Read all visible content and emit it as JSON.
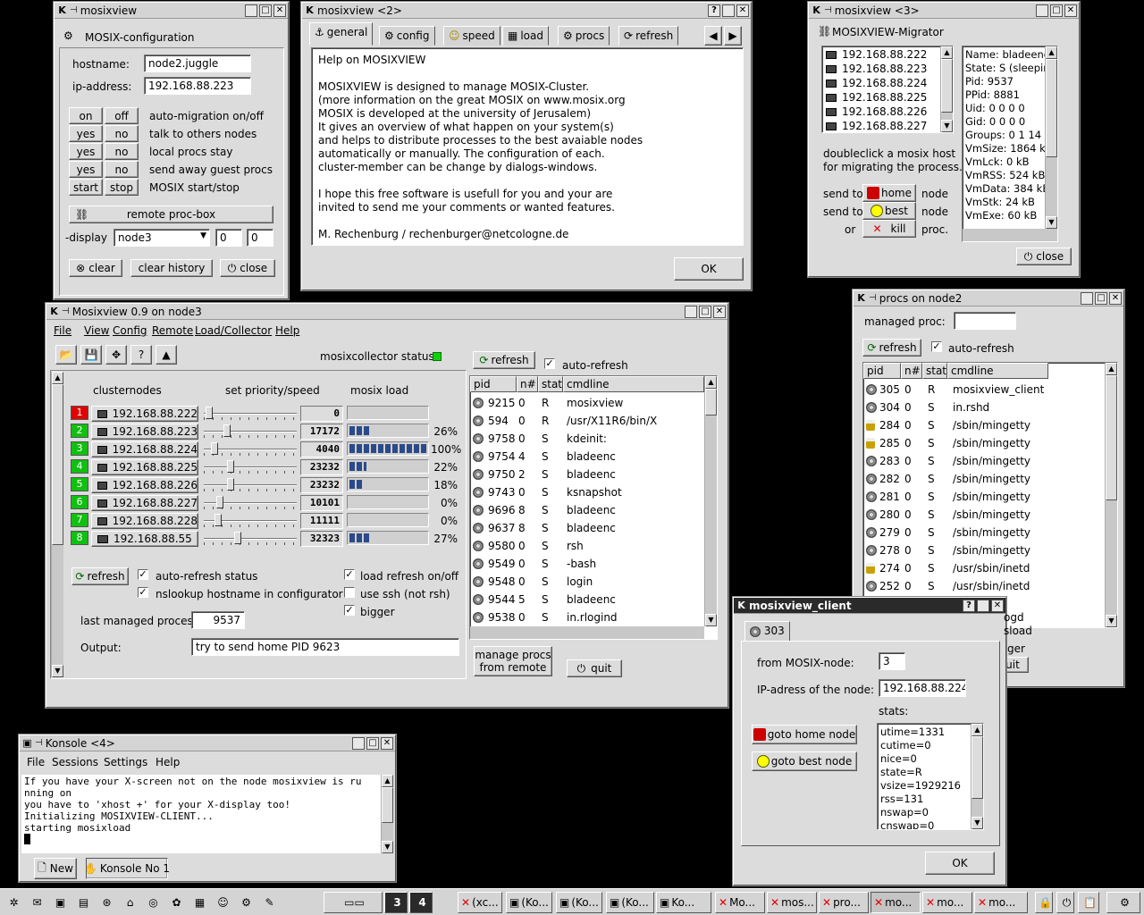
{
  "config_win": {
    "title": "mosixview",
    "heading": "MOSIX-configuration",
    "hostname_label": "hostname:",
    "hostname": "node2.juggle",
    "ip_label": "ip-address:",
    "ip": "192.168.88.223",
    "toggles": [
      {
        "a": "on",
        "b": "off",
        "desc": "auto-migration on/off"
      },
      {
        "a": "yes",
        "b": "no",
        "desc": "talk to others nodes"
      },
      {
        "a": "yes",
        "b": "no",
        "desc": "local procs stay"
      },
      {
        "a": "yes",
        "b": "no",
        "desc": "send away guest procs"
      },
      {
        "a": "start",
        "b": "stop",
        "desc": "MOSIX start/stop"
      }
    ],
    "remote_btn": "remote proc-box",
    "display_label": "-display",
    "display_value": "node3",
    "spin1": "0",
    "spin2": "0",
    "clear": "clear",
    "clear_history": "clear history",
    "close": "close"
  },
  "help_win": {
    "title": "mosixview <2>",
    "tabs": [
      "general",
      "config",
      "speed",
      "load",
      "procs",
      "refresh"
    ],
    "lines": [
      "Help on MOSIXVIEW",
      "",
      "MOSIXVIEW is designed to manage MOSIX-Cluster.",
      "(more information on the great MOSIX on www.mosix.org",
      "MOSIX is developed at the university of Jerusalem)",
      "It gives an overview of what happen on your system(s)",
      "and helps to distribute processes to the best avaiable nodes",
      "automatically or manually. The configuration of each.",
      "cluster-member can be change by dialogs-windows.",
      "",
      "I hope this free software is usefull for you and your are",
      "invited to send me your comments or wanted features.",
      "",
      "M. Rechenburg / rechenburger@netcologne.de"
    ],
    "ok": "OK"
  },
  "migrator_win": {
    "title": "mosixview <3>",
    "heading": "MOSIXVIEW-Migrator",
    "hosts": [
      "192.168.88.222",
      "192.168.88.223",
      "192.168.88.224",
      "192.168.88.225",
      "192.168.88.226",
      "192.168.88.227"
    ],
    "info": [
      "Name: bladeenc",
      "State: S (sleeping",
      "Pid: 9537",
      "PPid: 8881",
      "Uid: 0 0 0 0",
      "Gid: 0 0 0 0",
      "Groups: 0 1 14 15",
      "VmSize: 1864 kB",
      "VmLck: 0 kB",
      "VmRSS: 524 kB",
      "VmData: 384 kB",
      "VmStk: 24 kB",
      "VmExe: 60 kB"
    ],
    "hint1": "doubleclick a mosix host",
    "hint2": "for migrating the process.",
    "send_to": "send to",
    "or": "or",
    "home": "home",
    "best": "best",
    "kill": "kill",
    "node": "node",
    "proc": "proc.",
    "close": "close"
  },
  "main_win": {
    "title": "Mosixview 0.9   on node3",
    "menu": [
      "File",
      "View",
      "Config",
      "Remote",
      "Load/Collector",
      "Help"
    ],
    "collector_status": "mosixcollector status",
    "col_nodes": "clusternodes",
    "col_prio": "set priority/speed",
    "col_load": "mosix load",
    "nodes": [
      {
        "n": "1",
        "ip": "192.168.88.222",
        "speed": "0",
        "load": 0,
        "pct": "",
        "color": "#e00000"
      },
      {
        "n": "2",
        "ip": "192.168.88.223",
        "speed": "17172",
        "load": 26,
        "pct": "26%",
        "color": "#10c010"
      },
      {
        "n": "3",
        "ip": "192.168.88.224",
        "speed": "4040",
        "load": 100,
        "pct": "100%",
        "color": "#10c010"
      },
      {
        "n": "4",
        "ip": "192.168.88.225",
        "speed": "23232",
        "load": 22,
        "pct": "22%",
        "color": "#10c010"
      },
      {
        "n": "5",
        "ip": "192.168.88.226",
        "speed": "23232",
        "load": 18,
        "pct": "18%",
        "color": "#10c010"
      },
      {
        "n": "6",
        "ip": "192.168.88.227",
        "speed": "10101",
        "load": 0,
        "pct": "0%",
        "color": "#10c010"
      },
      {
        "n": "7",
        "ip": "192.168.88.228",
        "speed": "11111",
        "load": 0,
        "pct": "0%",
        "color": "#10c010"
      },
      {
        "n": "8",
        "ip": "192.168.88.55",
        "speed": "32323",
        "load": 27,
        "pct": "27%",
        "color": "#10c010"
      }
    ],
    "refresh": "refresh",
    "auto_refresh_status": "auto-refresh status",
    "nslookup": "nslookup hostname in configurator",
    "load_refresh": "load refresh on/off",
    "use_ssh": "use ssh (not rsh)",
    "bigger": "bigger",
    "last_label": "last managed process",
    "last_value": "9537",
    "output_label": "Output:",
    "output_value": "try to send home PID 9623",
    "proc_refresh": "refresh",
    "proc_auto": "auto-refresh",
    "proc_cols": [
      "pid",
      "n#",
      "stat",
      "cmdline"
    ],
    "procs": [
      [
        "9215",
        "0",
        "R",
        "mosixview"
      ],
      [
        "594",
        "0",
        "R",
        "/usr/X11R6/bin/X"
      ],
      [
        "9758",
        "0",
        "S",
        "kdeinit:"
      ],
      [
        "9754",
        "4",
        "S",
        "bladeenc"
      ],
      [
        "9750",
        "2",
        "S",
        "bladeenc"
      ],
      [
        "9743",
        "0",
        "S",
        "ksnapshot"
      ],
      [
        "9696",
        "8",
        "S",
        "bladeenc"
      ],
      [
        "9637",
        "8",
        "S",
        "bladeenc"
      ],
      [
        "9580",
        "0",
        "S",
        "rsh"
      ],
      [
        "9549",
        "0",
        "S",
        "-bash"
      ],
      [
        "9548",
        "0",
        "S",
        "login"
      ],
      [
        "9544",
        "5",
        "S",
        "bladeenc"
      ],
      [
        "9538",
        "0",
        "S",
        "in.rlogind"
      ]
    ],
    "manage1": "manage procs",
    "manage2": "from remote",
    "quit": "quit"
  },
  "procs_win": {
    "title": "procs on node2",
    "managed_label": "managed proc:",
    "refresh": "refresh",
    "auto": "auto-refresh",
    "cols": [
      "pid",
      "n#",
      "stat",
      "cmdline"
    ],
    "rows": [
      [
        "305",
        "0",
        "R",
        "mosixview_client",
        "g"
      ],
      [
        "304",
        "0",
        "S",
        "in.rshd",
        "g"
      ],
      [
        "284",
        "0",
        "S",
        "/sbin/mingetty",
        "l"
      ],
      [
        "285",
        "0",
        "S",
        "/sbin/mingetty",
        "l"
      ],
      [
        "283",
        "0",
        "S",
        "/sbin/mingetty",
        "g"
      ],
      [
        "282",
        "0",
        "S",
        "/sbin/mingetty",
        "g"
      ],
      [
        "281",
        "0",
        "S",
        "/sbin/mingetty",
        "g"
      ],
      [
        "280",
        "0",
        "S",
        "/sbin/mingetty",
        "g"
      ],
      [
        "279",
        "0",
        "S",
        "/sbin/mingetty",
        "g"
      ],
      [
        "278",
        "0",
        "S",
        "/sbin/mingetty",
        "g"
      ],
      [
        "274",
        "0",
        "S",
        "/usr/sbin/inetd",
        "l"
      ],
      [
        "252",
        "0",
        "S",
        "/usr/sbin/inetd",
        "g"
      ]
    ],
    "peek1": "ogd",
    "peek2": "sload",
    "peek3": "ger",
    "peek4": "uit"
  },
  "client_win": {
    "title": "mosixview_client",
    "tab": "303",
    "from_label": "from MOSIX-node:",
    "from_value": "3",
    "ip_label": "IP-adress of the node:",
    "ip_value": "192.168.88.224",
    "stats_label": "stats:",
    "stats": [
      "utime=1331",
      "cutime=0",
      "nice=0",
      "state=R",
      "vsize=1929216",
      "rss=131",
      "nswap=0",
      "cnswap=0"
    ],
    "goto_home": "goto home node",
    "goto_best": "goto best node",
    "ok": "OK"
  },
  "konsole_win": {
    "title": "Konsole <4>",
    "menu": [
      "File",
      "Sessions",
      "Settings",
      "Help"
    ],
    "lines": [
      "If you have your X-screen not on the node mosixview is ru",
      "nning on",
      "you have to 'xhost +' for your X-display too!",
      "Initializing MOSIXVIEW-CLIENT...",
      "starting mosixload"
    ],
    "new": "New",
    "tab": "Konsole No 1"
  },
  "taskbar": {
    "desk3": "3",
    "desk4": "4",
    "items": [
      "(xc...",
      "(Ko...",
      "(Ko...",
      "(Ko...",
      "Ko...",
      "Mo...",
      "mos...",
      "pro...",
      "mo...",
      "mo...",
      "mo..."
    ]
  }
}
